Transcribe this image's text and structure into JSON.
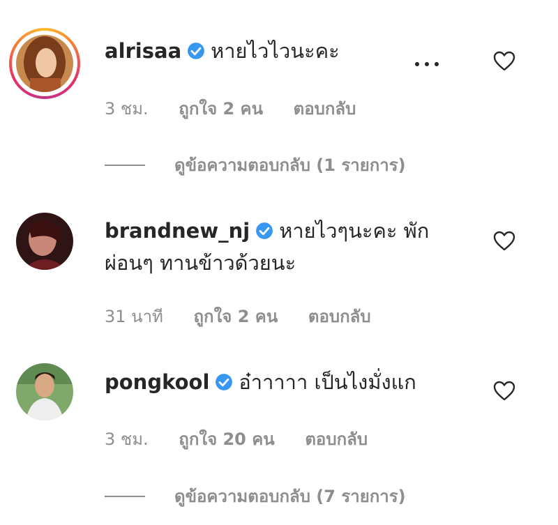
{
  "comments": [
    {
      "username": "alrisaa",
      "text": "หายไวไวนะคะ",
      "time": "3 ชม.",
      "likes": "ถูกใจ 2 คน",
      "reply_label": "ตอบกลับ",
      "view_replies": "ดูข้อความตอบกลับ (1 รายการ)"
    },
    {
      "username": "brandnew_nj",
      "text_line1": "หายไวๆนะคะ พัก",
      "text_line2": "ผ่อนๆ ทานข้าวด้วยนะ",
      "time": "31 นาที",
      "likes": "ถูกใจ 2 คน",
      "reply_label": "ตอบกลับ"
    },
    {
      "username": "pongkool",
      "text": "อ๋าาาาา เป็นไงมั่งแก",
      "time": "3 ชม.",
      "likes": "ถูกใจ 20 คน",
      "reply_label": "ตอบกลับ",
      "view_replies": "ดูข้อความตอบกลับ (7 รายการ)"
    }
  ],
  "icons": {
    "verified": "verified-badge-icon",
    "heart": "heart-outline-icon",
    "more": "more-options-icon"
  },
  "colors": {
    "verified": "#3897f0",
    "meta_text": "#8e8e8e",
    "primary_text": "#262626"
  }
}
